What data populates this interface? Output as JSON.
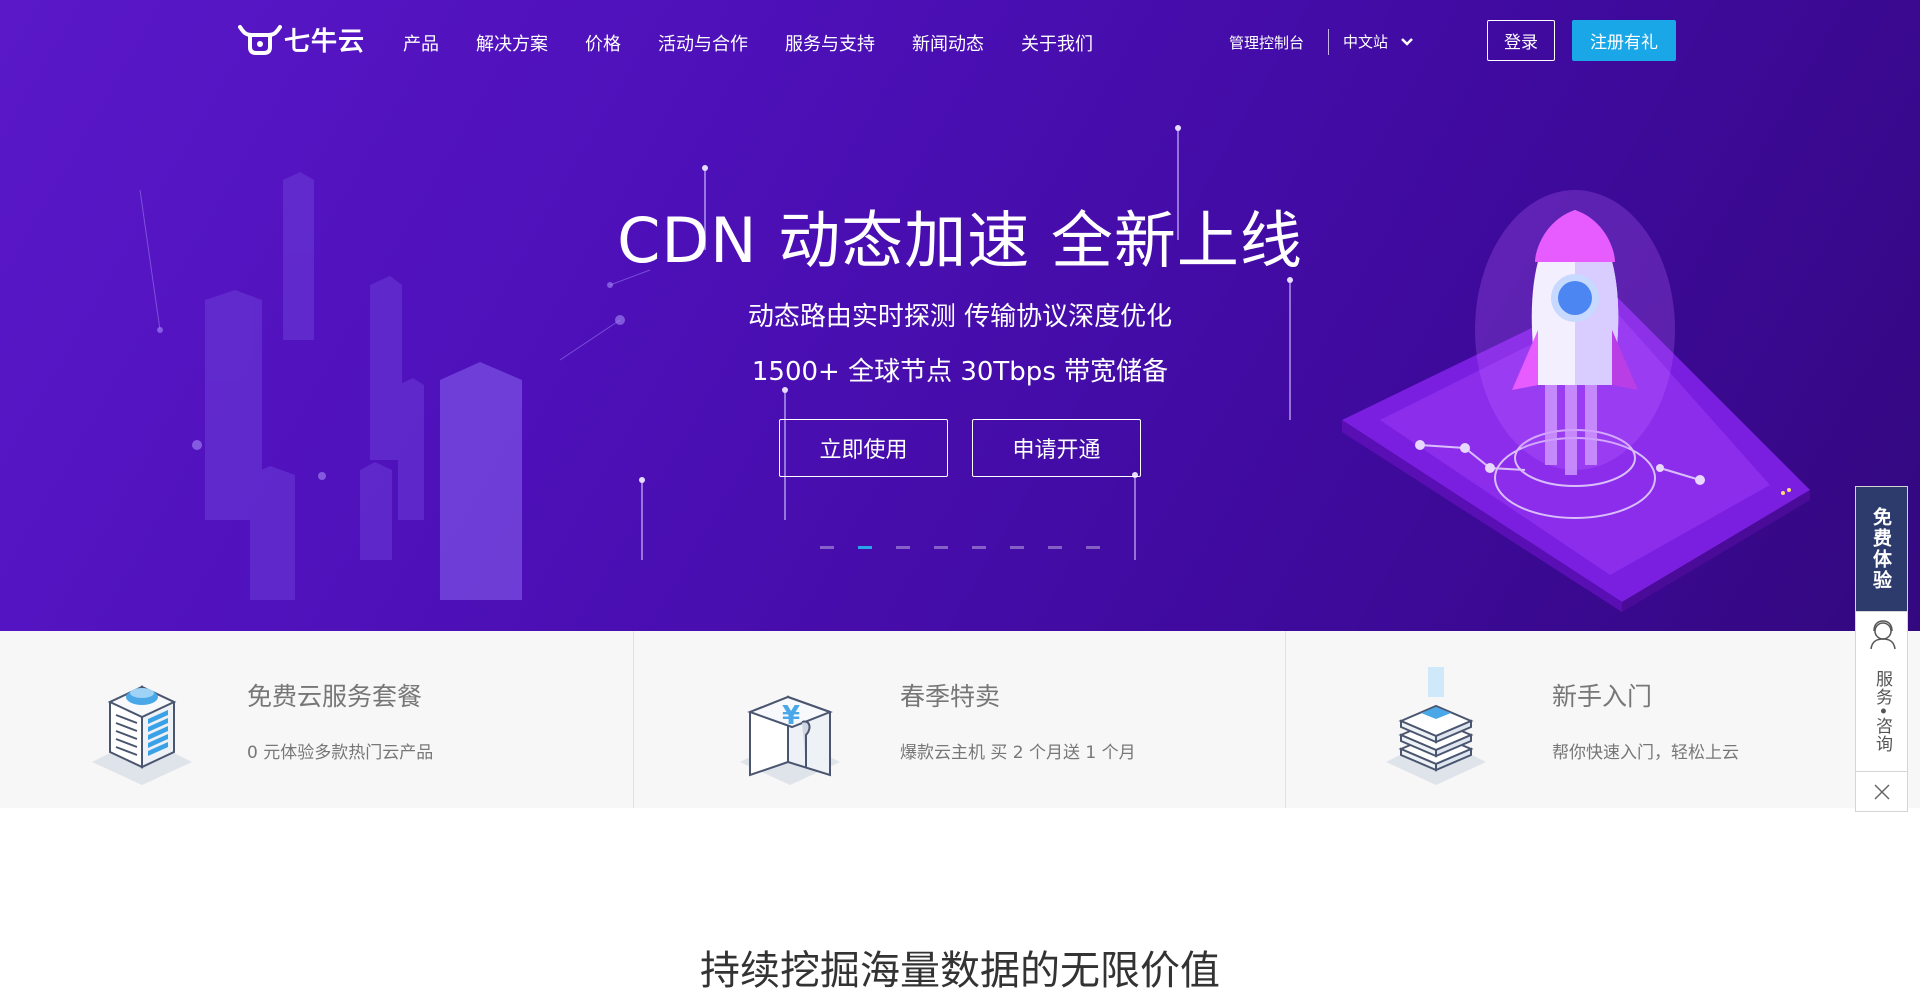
{
  "nav": {
    "logo_text": "七牛云",
    "menu": [
      "产品",
      "解决方案",
      "价格",
      "活动与合作",
      "服务与支持",
      "新闻动态",
      "关于我们"
    ],
    "console": "管理控制台",
    "language": "中文站",
    "login": "登录",
    "signup": "注册有礼"
  },
  "hero": {
    "title": "CDN 动态加速 全新上线",
    "subtitle1": "动态路由实时探测 传输协议深度优化",
    "subtitle2": "1500+ 全球节点 30Tbps 带宽储备",
    "cta_primary": "立即使用",
    "cta_secondary": "申请开通",
    "slide_count": 8,
    "active_slide_index": 1
  },
  "features": [
    {
      "title": "免费云服务套餐",
      "desc": "0 元体验多款热门云产品",
      "icon": "server-building-icon"
    },
    {
      "title": "春季特卖",
      "desc": "爆款云主机 买 2 个月送 1 个月",
      "icon": "yuan-box-icon"
    },
    {
      "title": "新手入门",
      "desc": "帮你快速入门，轻松上云",
      "icon": "layers-stack-icon"
    }
  ],
  "floating": {
    "trial": "免费体验",
    "service": "服务•咨询"
  },
  "section_heading": "持续挖掘海量数据的无限价值",
  "colors": {
    "hero_start": "#5a18c9",
    "hero_end": "#33087f",
    "signup_bg": "#1aa7e8",
    "active_dot": "#27a5ea",
    "trial_tab": "#2c3b6c"
  }
}
